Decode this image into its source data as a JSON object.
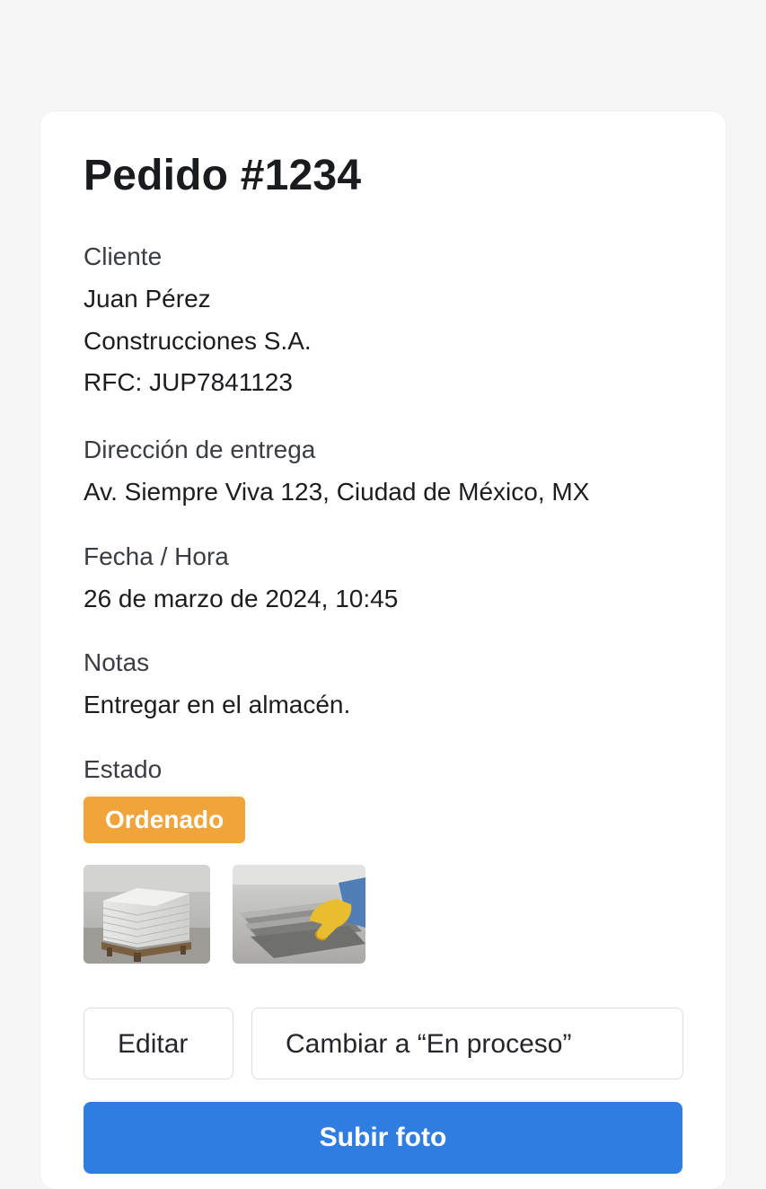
{
  "order": {
    "title": "Pedido #1234"
  },
  "client": {
    "label": "Cliente",
    "name": "Juan Pérez",
    "company": "Construcciones S.A.",
    "rfc": "RFC: JUP7841123"
  },
  "delivery": {
    "label": "Dirección de entrega",
    "address": "Av. Siempre Viva 123, Ciudad de México, MX"
  },
  "datetime": {
    "label": "Fecha / Hora",
    "value": "26 de marzo de 2024, 10:45"
  },
  "notes": {
    "label": "Notas",
    "value": "Entregar en el almacén."
  },
  "status": {
    "label": "Estado",
    "value": "Ordenado",
    "color": "#f0a43a"
  },
  "photos": [
    {
      "subject": "stacked concrete slabs on pallet"
    },
    {
      "subject": "gloved hand holding stone slabs"
    }
  ],
  "actions": {
    "edit_label": "Editar",
    "change_status_label": "Cambiar a “En proceso”",
    "upload_photo_label": "Subir foto",
    "primary_color": "#2f7de1"
  }
}
